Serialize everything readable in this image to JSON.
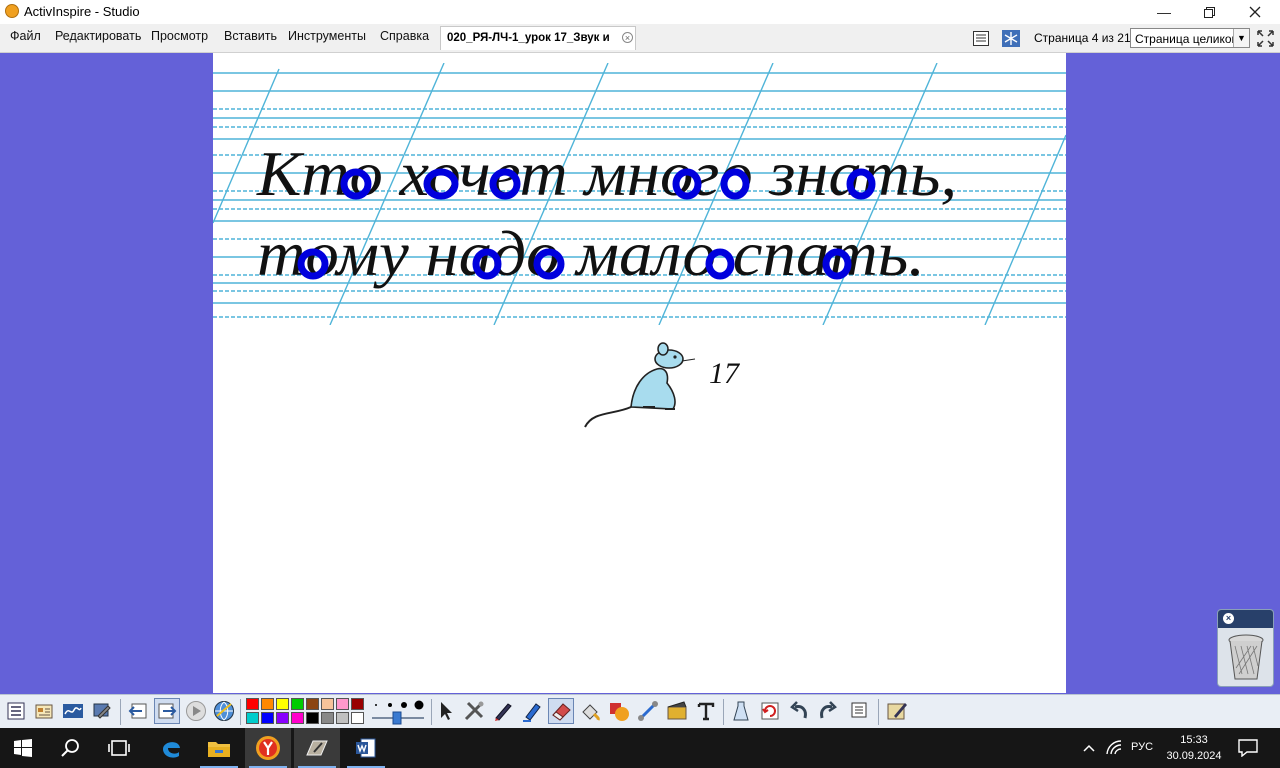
{
  "window": {
    "title": "ActivInspire - Studio",
    "controls": [
      "minimize-icon",
      "restore-icon",
      "close-icon"
    ]
  },
  "menu": {
    "items": [
      "Файл",
      "Редактировать",
      "Просмотр",
      "Вставить",
      "Инструменты",
      "Справка"
    ]
  },
  "document_tab": {
    "label": "020_РЯ-ЛЧ-1_урок 17_Звук и",
    "close_icon": "close-circle-icon"
  },
  "page_nav": {
    "counter": "Страница 4 из 21",
    "zoom_value": "Страница целиком",
    "icons": [
      "page-browser-icon",
      "snowflake-icon",
      "fullscreen-icon"
    ]
  },
  "flipchart": {
    "line1": "Кто хочет много знать,",
    "line2": "тому надо мало спать.",
    "page_number": "17",
    "illustration": "mouse-icon",
    "colors": {
      "workspace_background": "#6461d8",
      "ruling_lines": "#4fb4d8",
      "handwriting": "#111111",
      "highlighted_vowels": "#0000dd"
    }
  },
  "trash": {
    "icon": "trash-bin-icon"
  },
  "toolbar": {
    "icons": [
      "main-menu-icon",
      "browsers-icon",
      "signature-icon",
      "tools-edit-icon",
      "previous-page-icon",
      "next-page-icon",
      "play-icon",
      "globe-icon",
      "select-icon",
      "tools-icon",
      "pen-icon",
      "highlighter-icon",
      "eraser-icon",
      "fill-icon",
      "shape-icon",
      "connector-icon",
      "clip-icon",
      "text-icon",
      "clear-icon",
      "reset-icon",
      "undo-icon",
      "redo-icon",
      "page-icon",
      "pen-mode-icon"
    ],
    "palette": [
      "#ff0000",
      "#ff8800",
      "#ffff00",
      "#00cc00",
      "#8b4513",
      "#f5c39a",
      "#ff99cc",
      "#990000",
      "#00cccc",
      "#0000ff",
      "#8800ff",
      "#ff00cc",
      "#000000",
      "#888888",
      "#c0c0c0",
      "#ffffff"
    ]
  },
  "taskbar": {
    "icons": [
      "windows-start-icon",
      "search-icon",
      "task-view-icon",
      "edge-icon",
      "file-explorer-icon",
      "yandex-browser-icon",
      "activinspire-icon",
      "word-icon"
    ],
    "tray": {
      "language": "РУС",
      "time": "15:33",
      "date": "30.09.2024",
      "icons": [
        "chevron-up-icon",
        "wifi-icon",
        "notifications-icon"
      ]
    }
  }
}
